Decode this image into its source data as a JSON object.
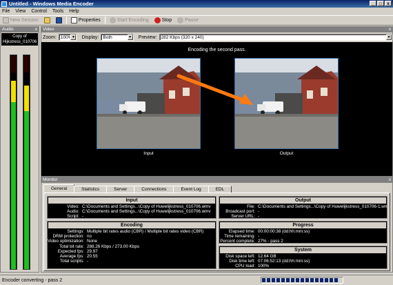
{
  "window": {
    "title": "Untitled - Windows Media Encoder",
    "buttons": [
      "_",
      "□",
      "x"
    ]
  },
  "menu": [
    "File",
    "View",
    "Control",
    "Tools",
    "Help"
  ],
  "toolbar": {
    "new_session": "New Session",
    "properties": "Properties",
    "start_encoding": "Start Encoding",
    "stop": "Stop",
    "pause": "Pause"
  },
  "audio_panel": {
    "title": "Audio",
    "file_line1": "Copy of",
    "file_line2": "Hijkstress_010706",
    "left_meter": {
      "green_level": 0.78,
      "yellow_level": 0.1
    },
    "right_meter": {
      "green_level": 0.74,
      "yellow_level": 0.12
    }
  },
  "video_panel": {
    "title": "Video",
    "zoom_label": "Zoom:",
    "zoom_value": "100%",
    "display_label": "Display:",
    "display_value": "Both",
    "preview_label": "Preview:",
    "preview_value": "282 Kbps (320 x 240)",
    "message": "Encoding the second pass.",
    "input_label": "Input",
    "output_label": "Output"
  },
  "monitor": {
    "title": "Monitor",
    "tabs": [
      "General",
      "Statistics",
      "Server",
      "Connections",
      "Event Log",
      "EDL"
    ],
    "input": {
      "title": "Input",
      "rows": [
        {
          "k": "Video:",
          "v": "C:\\Documents and Settings...\\Copy of Huwelijkstress_010706.wmv"
        },
        {
          "k": "Audio:",
          "v": "C:\\Documents and Settings...\\Copy of Huwelijkstress_010706.wmv"
        },
        {
          "k": "Script:",
          "v": "-"
        }
      ]
    },
    "output": {
      "title": "Output",
      "rows": [
        {
          "k": "File:",
          "v": "C:\\Documents and Settings...\\Copy of Huwelijkstress_010706-1.wmv"
        },
        {
          "k": "Broadcast port:",
          "v": "-"
        },
        {
          "k": "Server URL:",
          "v": "-"
        }
      ]
    },
    "encoding": {
      "title": "Encoding",
      "rows": [
        {
          "k": "Settings:",
          "v": "Multiple bit rates audio (CBR) / Multiple bit rates video (CBR)"
        },
        {
          "k": "DRM protection:",
          "v": "no"
        },
        {
          "k": "Video optimization:",
          "v": "None"
        },
        {
          "k": "Total bit rate:",
          "v": "288.26 Kbps / 273.00 Kbps"
        },
        {
          "k": "Expected fps:",
          "v": "29.97"
        },
        {
          "k": "Average fps:",
          "v": "20.55"
        },
        {
          "k": "Total scripts:",
          "v": "-"
        }
      ]
    },
    "progress": {
      "title": "Progress",
      "rows": [
        {
          "k": "Elapsed time:",
          "v": "00:00:00:38  (dd:hh:mm:ss)"
        },
        {
          "k": "Time remaining:",
          "v": "-"
        },
        {
          "k": "Percent complete:",
          "v": "27% - pass 2"
        }
      ]
    },
    "system": {
      "title": "System",
      "rows": [
        {
          "k": "Disk space left:",
          "v": "12.64 GB"
        },
        {
          "k": "Disk time left:",
          "v": "07:06:52:13  (dd:hh:mm:ss)"
        },
        {
          "k": "CPU load:",
          "v": "100%"
        }
      ]
    }
  },
  "statusbar": {
    "text": "Encoder converting - pass 2",
    "progress_fraction": 0.95
  }
}
